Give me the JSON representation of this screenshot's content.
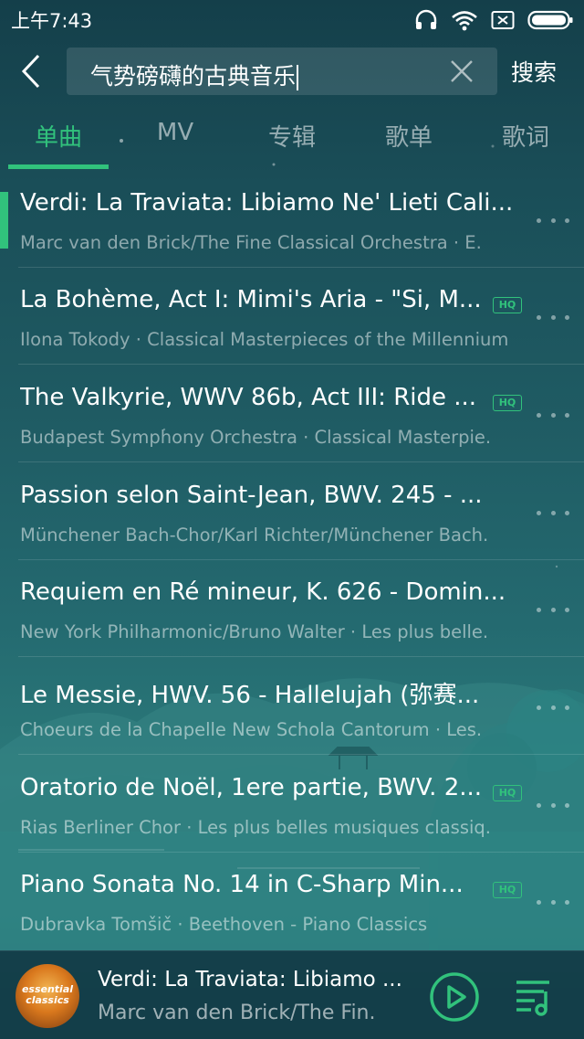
{
  "status_bar": {
    "time": "上午7:43",
    "icons": [
      "headphones-icon",
      "wifi-icon",
      "sim-icon",
      "battery-icon"
    ]
  },
  "search": {
    "query": "气势磅礴的古典音乐",
    "search_label": "搜索"
  },
  "tabs": [
    {
      "label": "单曲",
      "active": true
    },
    {
      "label": "MV",
      "active": false
    },
    {
      "label": "专辑",
      "active": false
    },
    {
      "label": "歌单",
      "active": false
    },
    {
      "label": "歌词",
      "active": false
    }
  ],
  "songs": [
    {
      "title": "Verdi: La Traviata: Libiamo Ne' Lieti Cali...",
      "subtitle": "Marc van den Brick/The Fine Classical Orchestra · E.",
      "hq": false,
      "playing": true
    },
    {
      "title": "La Bohème, Act I: Mimi's Aria - \"Si, M...",
      "subtitle": "Ilona Tokody · Classical Masterpieces of the Millennium",
      "hq": true,
      "playing": false
    },
    {
      "title": "The Valkyrie, WWV 86b, Act III: Ride ...",
      "subtitle": "Budapest Symphony Orchestra · Classical Masterpie.",
      "hq": true,
      "playing": false
    },
    {
      "title": "Passion selon Saint-Jean, BWV. 245 - ...",
      "subtitle": "Münchener Bach-Chor/Karl Richter/Münchener Bach.",
      "hq": false,
      "playing": false
    },
    {
      "title": "Requiem en Ré mineur, K. 626 - Domin...",
      "subtitle": "New York Philharmonic/Bruno Walter · Les plus belle.",
      "hq": false,
      "playing": false
    },
    {
      "title": "Le Messie, HWV. 56 - Hallelujah (弥赛...",
      "subtitle": "Choeurs de la Chapelle New Schola Cantorum · Les.",
      "hq": false,
      "playing": false
    },
    {
      "title": "Oratorio de Noël, 1ere partie, BWV. 2...",
      "subtitle": "Rias Berliner Chor · Les plus belles musiques classiq.",
      "hq": true,
      "playing": false
    },
    {
      "title": "Piano Sonata No. 14 in C-Sharp Min...",
      "subtitle": "Dubravka Tomšič · Beethoven - Piano Classics",
      "hq": true,
      "playing": false
    }
  ],
  "hq_label": "HQ",
  "player": {
    "title": "Verdi: La Traviata: Libiamo ...",
    "artist": "Marc van den Brick/The Fin.",
    "cover_text": "essential classics"
  },
  "colors": {
    "accent": "#31c27c"
  }
}
